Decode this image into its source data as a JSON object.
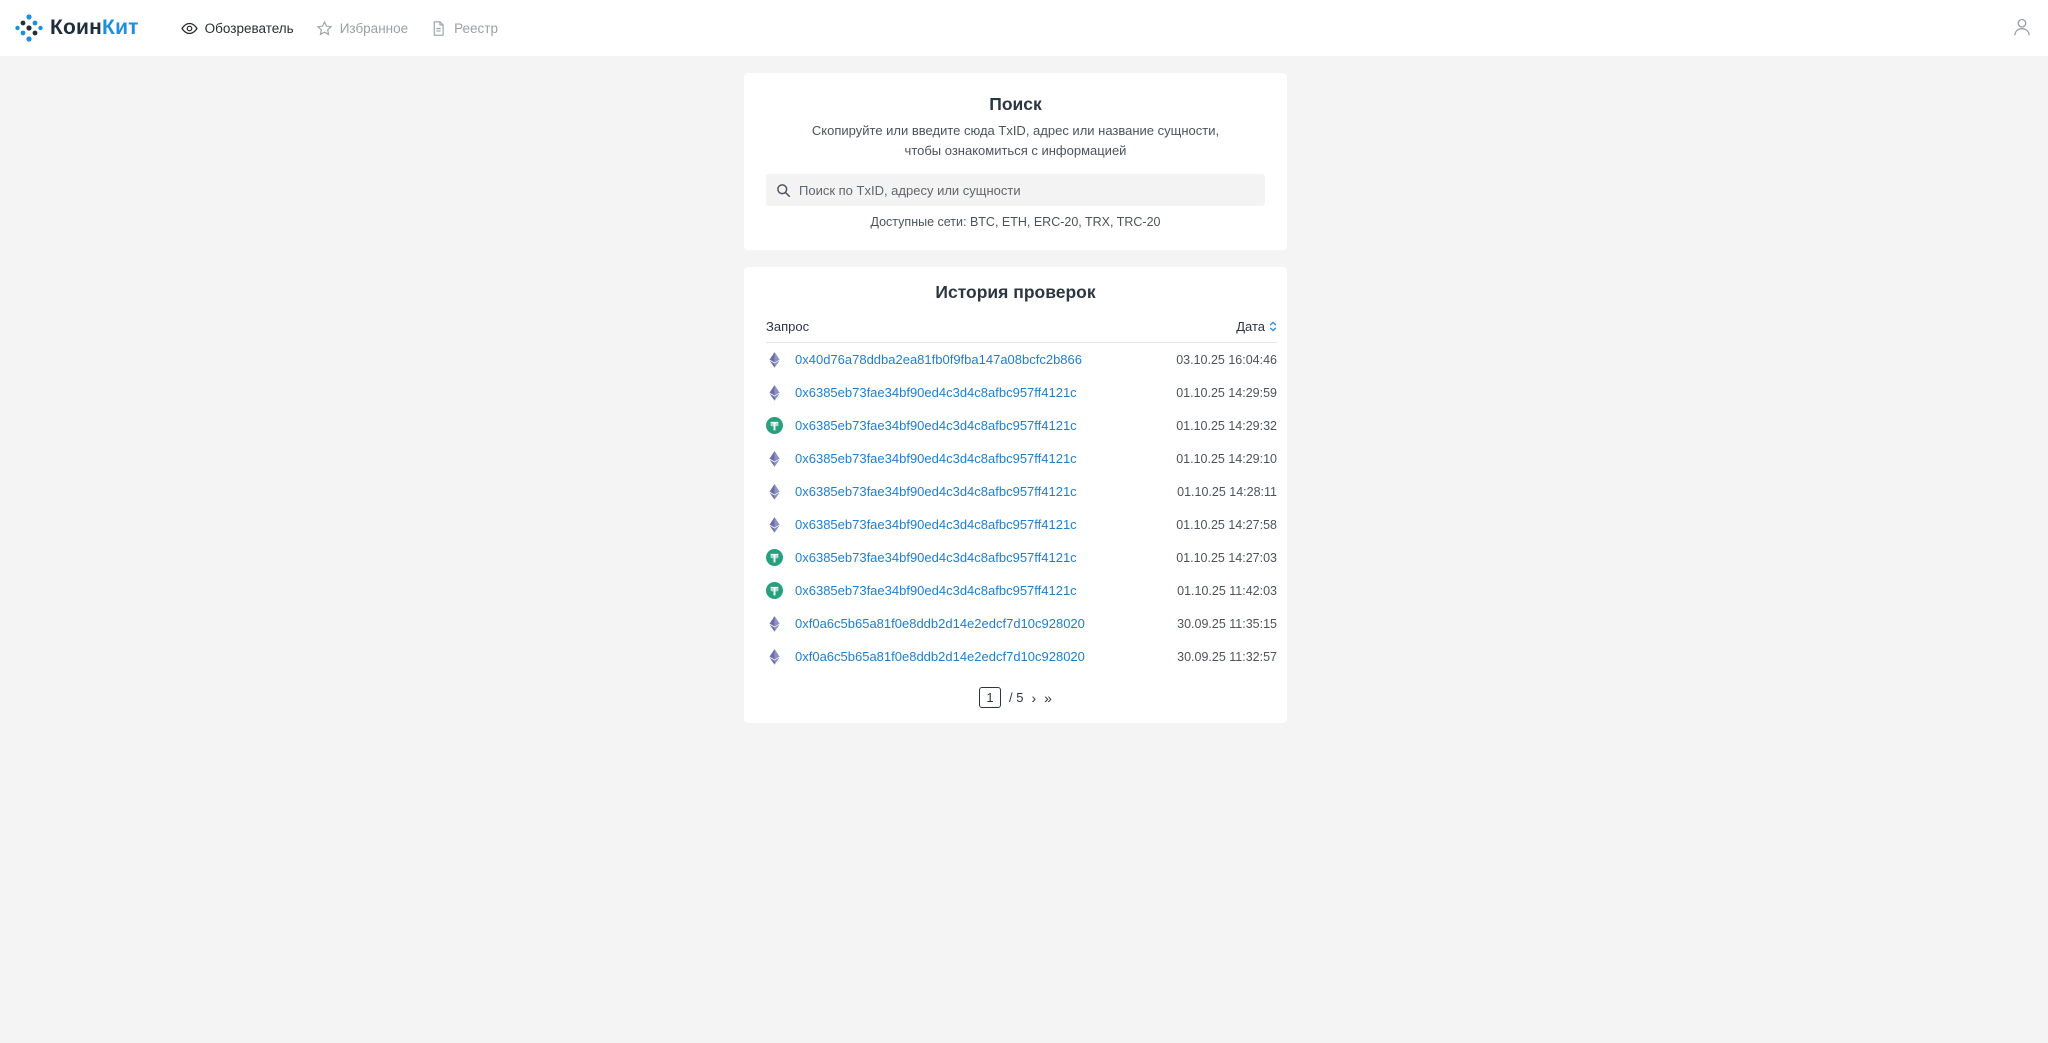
{
  "brand": {
    "part1": "Коин",
    "part2": "Кит"
  },
  "nav": [
    {
      "label": "Обозреватель",
      "active": true,
      "icon": "eye-icon"
    },
    {
      "label": "Избранное",
      "active": false,
      "icon": "star-icon"
    },
    {
      "label": "Реестр",
      "active": false,
      "icon": "document-icon"
    }
  ],
  "search": {
    "title": "Поиск",
    "desc_line1": "Скопируйте или введите сюда TxID, адрес или название сущности,",
    "desc_line2": "чтобы ознакомиться с информацией",
    "placeholder": "Поиск по TxID, адресу или сущности",
    "networks": "Доступные сети: BTC, ETH, ERC-20, TRX, TRC-20"
  },
  "history": {
    "title": "История проверок",
    "col_query": "Запрос",
    "col_date": "Дата",
    "rows": [
      {
        "coin": "eth",
        "query": "0x40d76a78ddba2ea81fb0f9fba147a08bcfc2b866",
        "date": "03.10.25 16:04:46"
      },
      {
        "coin": "eth",
        "query": "0x6385eb73fae34bf90ed4c3d4c8afbc957ff4121c",
        "date": "01.10.25 14:29:59"
      },
      {
        "coin": "tether",
        "query": "0x6385eb73fae34bf90ed4c3d4c8afbc957ff4121c",
        "date": "01.10.25 14:29:32"
      },
      {
        "coin": "eth",
        "query": "0x6385eb73fae34bf90ed4c3d4c8afbc957ff4121c",
        "date": "01.10.25 14:29:10"
      },
      {
        "coin": "eth",
        "query": "0x6385eb73fae34bf90ed4c3d4c8afbc957ff4121c",
        "date": "01.10.25 14:28:11"
      },
      {
        "coin": "eth",
        "query": "0x6385eb73fae34bf90ed4c3d4c8afbc957ff4121c",
        "date": "01.10.25 14:27:58"
      },
      {
        "coin": "tether",
        "query": "0x6385eb73fae34bf90ed4c3d4c8afbc957ff4121c",
        "date": "01.10.25 14:27:03"
      },
      {
        "coin": "tether",
        "query": "0x6385eb73fae34bf90ed4c3d4c8afbc957ff4121c",
        "date": "01.10.25 11:42:03"
      },
      {
        "coin": "eth",
        "query": "0xf0a6c5b65a81f0e8ddb2d14e2edcf7d10c928020",
        "date": "30.09.25 11:35:15"
      },
      {
        "coin": "eth",
        "query": "0xf0a6c5b65a81f0e8ddb2d14e2edcf7d10c928020",
        "date": "30.09.25 11:32:57"
      }
    ],
    "pagination": {
      "current": "1",
      "total": "/ 5",
      "next": "›",
      "last": "»"
    }
  },
  "colors": {
    "accent": "#1c8fe0",
    "link": "#1c7fd0",
    "eth": "#6a6fa8",
    "tether": "#26a17b",
    "background": "#f4f4f4"
  }
}
